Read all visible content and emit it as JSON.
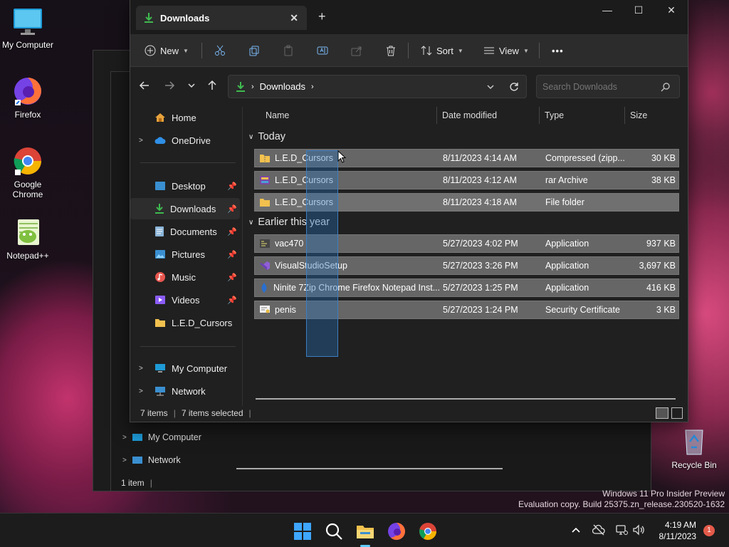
{
  "desktop": {
    "icons": [
      {
        "label": "My Computer"
      },
      {
        "label": "Firefox"
      },
      {
        "label": "Google Chrome"
      },
      {
        "label": "Notepad++"
      },
      {
        "label": "Recycle Bin"
      }
    ],
    "watermark": [
      "Windows 11 Pro Insider Preview",
      "Evaluation copy. Build 25375.zn_release.230520-1632"
    ]
  },
  "bg_window": {
    "nav": [
      {
        "label": "My Computer"
      },
      {
        "label": "Network"
      }
    ],
    "status": {
      "items": "1 item"
    }
  },
  "window": {
    "tab_title": "Downloads",
    "new_tab": "+",
    "controls": {
      "minimize": "—",
      "maximize": "☐",
      "close": "✕"
    },
    "toolbar": {
      "new_label": "New",
      "sort_label": "Sort",
      "view_label": "View",
      "more_label": "•••"
    },
    "address": {
      "path": "Downloads"
    },
    "search": {
      "placeholder": "Search Downloads"
    },
    "nav": {
      "home": "Home",
      "onedrive": "OneDrive",
      "pinned": [
        {
          "label": "Desktop"
        },
        {
          "label": "Downloads"
        },
        {
          "label": "Documents"
        },
        {
          "label": "Pictures"
        },
        {
          "label": "Music"
        },
        {
          "label": "Videos"
        },
        {
          "label": "L.E.D_Cursors"
        }
      ],
      "my_computer": "My Computer",
      "network": "Network"
    },
    "columns": {
      "name": "Name",
      "date": "Date modified",
      "type": "Type",
      "size": "Size"
    },
    "groups": {
      "today": "Today",
      "earlier": "Earlier this year"
    },
    "files_today": [
      {
        "name": "L.E.D_Cursors",
        "date": "8/11/2023 4:14 AM",
        "type": "Compressed (zipp...",
        "size": "30 KB",
        "icon": "zip-icon"
      },
      {
        "name": "L.E.D_Cursors",
        "date": "8/11/2023 4:12 AM",
        "type": "rar Archive",
        "size": "38 KB",
        "icon": "rar-icon"
      },
      {
        "name": "L.E.D_Cursors",
        "date": "8/11/2023 4:18 AM",
        "type": "File folder",
        "size": "",
        "icon": "folder-icon"
      }
    ],
    "files_earlier": [
      {
        "name": "vac470",
        "date": "5/27/2023 4:02 PM",
        "type": "Application",
        "size": "937 KB",
        "icon": "app-icon"
      },
      {
        "name": "VisualStudioSetup",
        "date": "5/27/2023 3:26 PM",
        "type": "Application",
        "size": "3,697 KB",
        "icon": "vs-icon"
      },
      {
        "name": "Ninite 7Zip Chrome Firefox Notepad Inst...",
        "date": "5/27/2023 1:25 PM",
        "type": "Application",
        "size": "416 KB",
        "icon": "ninite-icon"
      },
      {
        "name": "penis",
        "date": "5/27/2023 1:24 PM",
        "type": "Security Certificate",
        "size": "3 KB",
        "icon": "certificate-icon"
      }
    ],
    "status": {
      "items": "7 items",
      "selected": "7 items selected"
    }
  },
  "taskbar": {
    "time": "4:19 AM",
    "date": "8/11/2023",
    "notifications": "1"
  },
  "colors": {
    "accent": "#3c7fc4",
    "download_green": "#3fb950",
    "folder_yellow": "#f2c14e"
  }
}
